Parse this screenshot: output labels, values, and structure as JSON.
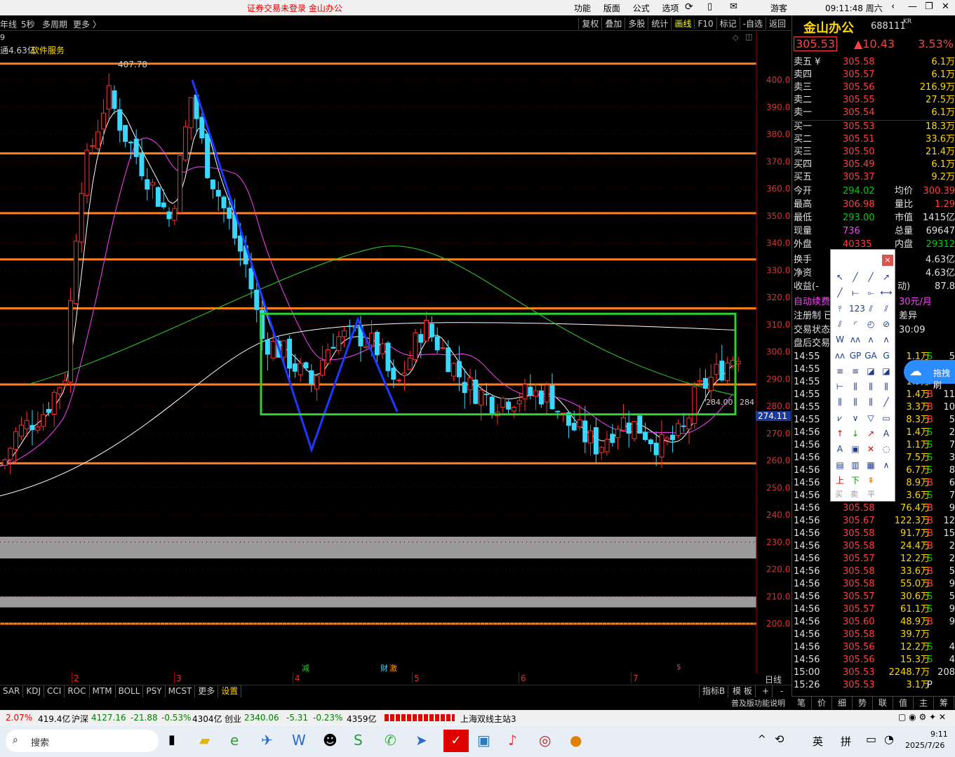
{
  "titlebar": {
    "notice": "证券交易未登录  金山办公",
    "menu": [
      "功能",
      "版面",
      "公式",
      "选项"
    ],
    "guest": "游客",
    "clock": "09:11:48 周六"
  },
  "toolbar": {
    "left": [
      "年线",
      "5秒",
      "多周期",
      "更多 〉"
    ],
    "right": [
      "复权",
      "叠加",
      "多股",
      "统计",
      "画线",
      "F10",
      "标记",
      "-自选",
      "返回"
    ],
    "active": "画线"
  },
  "chart_info": {
    "volume_note": "通4.63亿",
    "sector": "软件服务",
    "high_label": "407.78",
    "price_marker": "274.11",
    "mid_label": "284.00",
    "right_cut_label": "284",
    "top_left": "9"
  },
  "chart_data": {
    "type": "candlestick",
    "ylim": [
      195,
      410
    ],
    "yticks": [
      400,
      390,
      380,
      370,
      360,
      350,
      340,
      330,
      320,
      310,
      300,
      290,
      280,
      270,
      260,
      250,
      240,
      230,
      220,
      210,
      200
    ],
    "xlabels": [
      "2",
      "3",
      "4",
      "5",
      "6",
      "7"
    ],
    "x_period_label": "日线",
    "event_markers": [
      "减",
      "财",
      "激",
      "$"
    ],
    "horizontal_levels": [
      406,
      373,
      351,
      334,
      316,
      288,
      259,
      200
    ],
    "box": {
      "top": 314,
      "bottom": 277
    }
  },
  "indicators": {
    "tabs": [
      "SAR",
      "KDJ",
      "CCI",
      "ROC",
      "MTM",
      "BOLL",
      "PSY",
      "MCST",
      "更多",
      "设置"
    ],
    "right": [
      "指标B",
      "模 板",
      "+",
      "-"
    ]
  },
  "quote": {
    "name": "金山办公",
    "code": "688111",
    "tag": "KR",
    "price": "305.53",
    "change": "▲10.43",
    "pct": "3.53%",
    "asks": [
      {
        "label": "卖五 ¥",
        "price": "305.58",
        "vol": "6.1万"
      },
      {
        "label": "卖四",
        "price": "305.57",
        "vol": "6.1万"
      },
      {
        "label": "卖三",
        "price": "305.56",
        "vol": "216.9万"
      },
      {
        "label": "卖二",
        "price": "305.55",
        "vol": "27.5万"
      },
      {
        "label": "卖一",
        "price": "305.54",
        "vol": "6.1万"
      }
    ],
    "bids": [
      {
        "label": "买一",
        "price": "305.53",
        "vol": "18.3万"
      },
      {
        "label": "买二",
        "price": "305.51",
        "vol": "33.6万"
      },
      {
        "label": "买三",
        "price": "305.50",
        "vol": "21.4万"
      },
      {
        "label": "买四",
        "price": "305.49",
        "vol": "6.1万"
      },
      {
        "label": "买五",
        "price": "305.37",
        "vol": "9.2万"
      }
    ],
    "stats": [
      {
        "a": "今开",
        "b": "294.02",
        "bc": "green",
        "c": "均价",
        "d": "300.39",
        "dc": "red"
      },
      {
        "a": "最高",
        "b": "306.98",
        "bc": "red",
        "c": "量比",
        "d": "1.29",
        "dc": "red"
      },
      {
        "a": "最低",
        "b": "293.00",
        "bc": "green",
        "c": "市值",
        "d": "1415亿",
        "dc": "white"
      },
      {
        "a": "现量",
        "b": "736",
        "bc": "mag",
        "c": "总量",
        "d": "69647",
        "dc": "white"
      },
      {
        "a": "外盘",
        "b": "40335",
        "bc": "red",
        "c": "内盘",
        "d": "29312",
        "dc": "green"
      }
    ],
    "extra": [
      {
        "a": "换手",
        "d": "4.63亿"
      },
      {
        "a": "净资",
        "d": "4.63亿"
      },
      {
        "a": "收益(-",
        "c": "动)",
        "d": "87.8"
      }
    ],
    "auto_fee": "自动续费",
    "fee": "30元/月",
    "reg": "注册制 已",
    "diff": "差异",
    "trade_state": "交易状态",
    "trade_time": "30:09",
    "after": "盘后交易"
  },
  "ticks": [
    {
      "t": "14:55",
      "p": "",
      "v": "1.1万",
      "s": "S",
      "n": "5"
    },
    {
      "t": "14:55",
      "p": "",
      "v": "5.",
      "s": "",
      "n": ""
    },
    {
      "t": "14:55",
      "p": "",
      "v": "1.9万",
      "s": "S",
      "n": ""
    },
    {
      "t": "14:55",
      "p": "",
      "v": "1.4万",
      "s": "B",
      "n": "11"
    },
    {
      "t": "14:55",
      "p": "",
      "v": "3.3万",
      "s": "B",
      "n": "10"
    },
    {
      "t": "14:55",
      "p": "",
      "v": "8.3万",
      "s": "B",
      "n": "5"
    },
    {
      "t": "14:56",
      "p": "",
      "v": "1.4万",
      "s": "S",
      "n": "2"
    },
    {
      "t": "14:56",
      "p": "",
      "v": "1.1万",
      "s": "S",
      "n": "7"
    },
    {
      "t": "14:56",
      "p": "",
      "v": "7.5万",
      "s": "S",
      "n": "3"
    },
    {
      "t": "14:56",
      "p": "",
      "v": "6.7万",
      "s": "S",
      "n": "8"
    },
    {
      "t": "14:56",
      "p": "",
      "v": "8.9万",
      "s": "B",
      "n": "6"
    },
    {
      "t": "14:56",
      "p": "",
      "v": "3.6万",
      "s": "S",
      "n": "7"
    },
    {
      "t": "14:56",
      "p": "305.58",
      "v": "76.4万",
      "s": "B",
      "n": "9"
    },
    {
      "t": "14:56",
      "p": "305.67",
      "v": "122.3万",
      "s": "B",
      "n": "12"
    },
    {
      "t": "14:56",
      "p": "305.58",
      "v": "91.7万",
      "s": "B",
      "n": "15"
    },
    {
      "t": "14:56",
      "p": "305.58",
      "v": "24.4万",
      "s": "B",
      "n": "2"
    },
    {
      "t": "14:56",
      "p": "305.57",
      "v": "12.2万",
      "s": "S",
      "n": "2"
    },
    {
      "t": "14:56",
      "p": "305.58",
      "v": "33.6万",
      "s": "B",
      "n": "5"
    },
    {
      "t": "14:56",
      "p": "305.58",
      "v": "55.0万",
      "s": "B",
      "n": "9"
    },
    {
      "t": "14:56",
      "p": "305.57",
      "v": "30.6万",
      "s": "S",
      "n": "5"
    },
    {
      "t": "14:56",
      "p": "305.57",
      "v": "61.1万",
      "s": "S",
      "n": "9"
    },
    {
      "t": "14:56",
      "p": "305.60",
      "v": "48.9万",
      "s": "B",
      "n": "9"
    },
    {
      "t": "14:56",
      "p": "305.58",
      "v": "39.7万",
      "s": "",
      "n": ""
    },
    {
      "t": "14:56",
      "p": "305.56",
      "v": "12.2万",
      "s": "S",
      "n": "4"
    },
    {
      "t": "14:56",
      "p": "305.56",
      "v": "15.3万",
      "s": "S",
      "n": "4"
    },
    {
      "t": "15:00",
      "p": "305.53",
      "v": "2248.7万",
      "s": "",
      "n": "208"
    },
    {
      "t": "15:26",
      "p": "305.53",
      "v": "3.1万",
      "s": "P",
      "n": ""
    }
  ],
  "bottom_tabs": [
    "笔",
    "价",
    "细",
    "势",
    "联",
    "值",
    "主",
    "筹"
  ],
  "bottom_note": "普及版功能说明",
  "statusbar": {
    "a": "2.07%",
    "b": "419.4亿",
    "c": "沪深",
    "d": "4127.16",
    "e": "-21.88",
    "f": "-0.53%",
    "g": "4304亿",
    "h": "创业",
    "i": "2340.06",
    "j": "-5.31",
    "k": "-0.23%",
    "l": "4359亿",
    "m": "上海双线主站3"
  },
  "taskbar": {
    "search": "搜索",
    "ime1": "英",
    "ime2": "拼",
    "time": "9:11",
    "date": "2025/7/26"
  },
  "toolbox": {
    "labels": [
      "买",
      "卖",
      "平"
    ],
    "close": "×"
  },
  "drag_badge": "拖拽刷"
}
